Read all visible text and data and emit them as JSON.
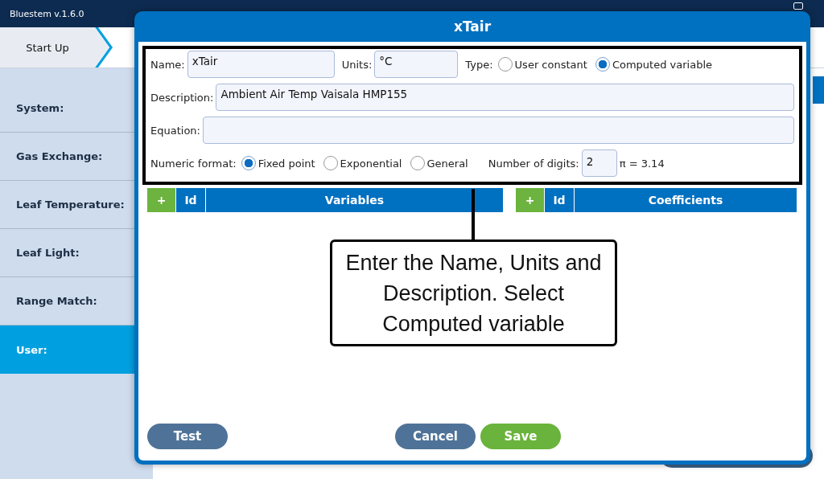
{
  "app": {
    "title": "Bluestem v.1.6.0"
  },
  "tabs": [
    {
      "label": "Start Up",
      "selected": true
    }
  ],
  "sidebar": {
    "items": [
      {
        "label": "System:",
        "selected": false
      },
      {
        "label": "Gas Exchange:",
        "selected": false
      },
      {
        "label": "Leaf Temperature:",
        "selected": false
      },
      {
        "label": "Leaf Light:",
        "selected": false
      },
      {
        "label": "Range Match:",
        "selected": false
      },
      {
        "label": "User:",
        "selected": true
      }
    ]
  },
  "dialog": {
    "title": "xTair",
    "name": {
      "label": "Name:",
      "value": "xTair"
    },
    "units": {
      "label": "Units:",
      "value": "°C"
    },
    "type": {
      "label": "Type:",
      "options": [
        {
          "label": "User constant",
          "selected": false
        },
        {
          "label": "Computed variable",
          "selected": true
        }
      ]
    },
    "description": {
      "label": "Description:",
      "value": "Ambient Air Temp Vaisala HMP155"
    },
    "equation": {
      "label": "Equation:"
    },
    "numeric_format": {
      "label": "Numeric format:",
      "options": [
        {
          "label": "Fixed point",
          "selected": true
        },
        {
          "label": "Exponential",
          "selected": false
        },
        {
          "label": "General",
          "selected": false
        }
      ]
    },
    "digits": {
      "label": "Number of digits:",
      "value": "2"
    },
    "preview": "π = 3.14",
    "tables": [
      {
        "add": "+",
        "id": "Id",
        "title": "Variables"
      },
      {
        "add": "+",
        "id": "Id",
        "title": "Coefficients"
      }
    ],
    "buttons": [
      {
        "label": "Test",
        "kind": "secondary"
      },
      {
        "label": "Cancel",
        "kind": "secondary"
      },
      {
        "label": "Save",
        "kind": "primary"
      }
    ]
  },
  "callout": {
    "text": "Enter the Name, Units and Description. Select Computed variable"
  }
}
